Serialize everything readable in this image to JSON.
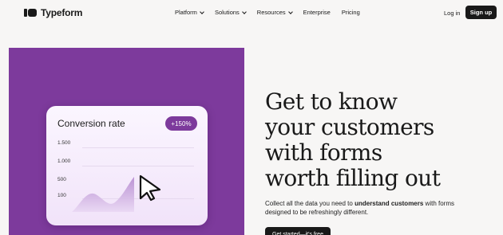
{
  "nav": {
    "brand": "Typeform",
    "menu": [
      {
        "label": "Platform",
        "dropdown": true
      },
      {
        "label": "Solutions",
        "dropdown": true
      },
      {
        "label": "Resources",
        "dropdown": true
      },
      {
        "label": "Enterprise",
        "dropdown": false
      },
      {
        "label": "Pricing",
        "dropdown": false
      }
    ],
    "login": "Log in",
    "signup": "Sign up"
  },
  "card": {
    "title": "Conversion rate",
    "badge": "+150%",
    "ticks": [
      "1.500",
      "1.000",
      "500",
      "100"
    ]
  },
  "hero": {
    "headline": [
      "Get to know",
      "your customers",
      "with forms",
      "worth filling out"
    ],
    "sub_pre": "Collect all the data you need to ",
    "sub_bold": "understand customers",
    "sub_post": " with forms designed to be refreshingly different.",
    "cta": "Get started—it's free"
  },
  "colors": {
    "accent": "#7d3a9c",
    "dark": "#191919",
    "bg": "#f7f6f5"
  }
}
